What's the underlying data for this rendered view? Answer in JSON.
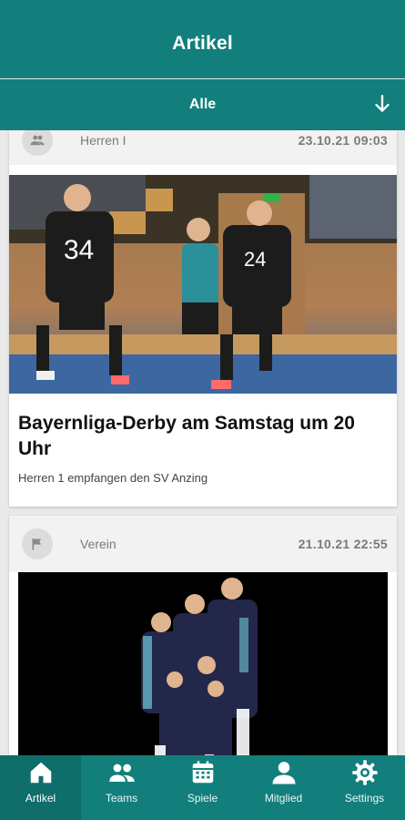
{
  "header": {
    "title": "Artikel"
  },
  "filter": {
    "label": "Alle",
    "arrow_icon": "arrow-down-icon"
  },
  "articles": [
    {
      "category_icon": "people-icon",
      "team": "Herren I",
      "date": "23.10.21 09:03",
      "title": "Bayernliga-Derby am Samstag um 20 Uhr",
      "subtitle": "Herren 1 empfangen den SV Anzing",
      "player_numbers": [
        "34",
        "24"
      ]
    },
    {
      "category_icon": "flag-icon",
      "team": "Verein",
      "date": "21.10.21 22:55"
    }
  ],
  "bottom_nav": [
    {
      "label": "Artikel",
      "icon": "home-icon",
      "active": true
    },
    {
      "label": "Teams",
      "icon": "people-icon",
      "active": false
    },
    {
      "label": "Spiele",
      "icon": "calendar-icon",
      "active": false
    },
    {
      "label": "Mitglied",
      "icon": "person-icon",
      "active": false
    },
    {
      "label": "Settings",
      "icon": "gear-icon",
      "active": false
    }
  ],
  "colors": {
    "primary": "#127f7c",
    "background": "#e9e9e9"
  }
}
